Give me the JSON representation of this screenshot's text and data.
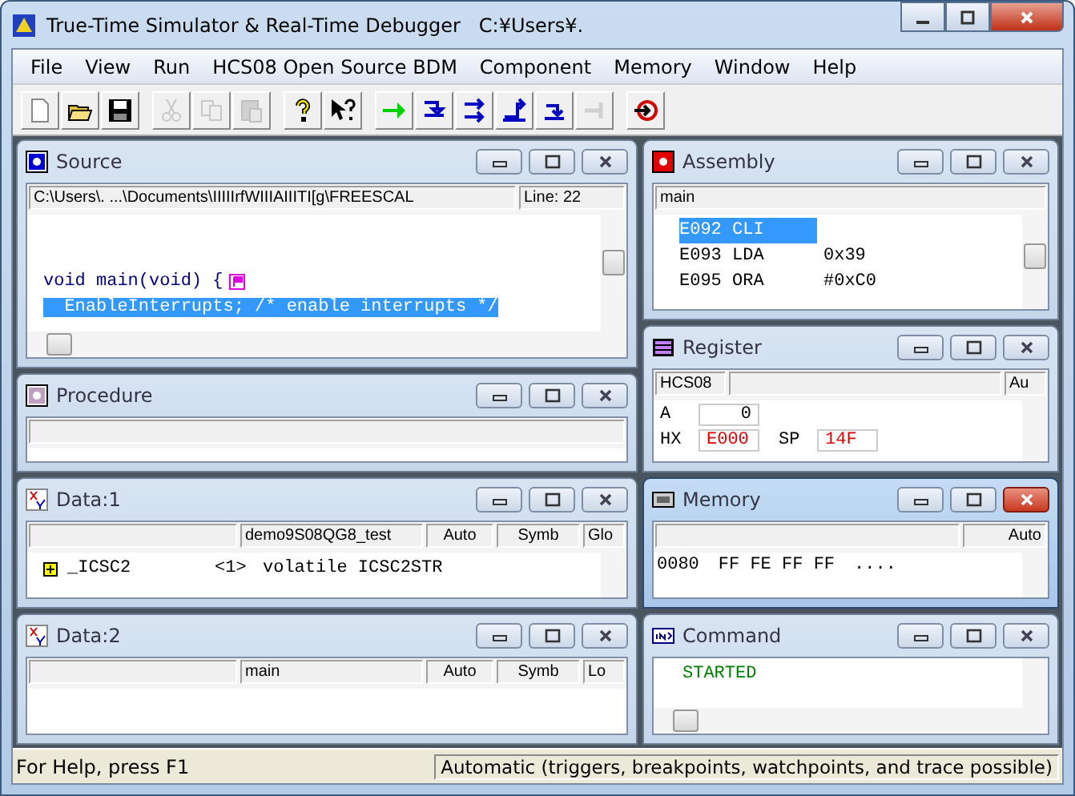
{
  "window": {
    "title": "True-Time Simulator & Real-Time Debugger   C:¥Users¥."
  },
  "menu": [
    "File",
    "View",
    "Run",
    "HCS08 Open Source BDM",
    "Component",
    "Memory",
    "Window",
    "Help"
  ],
  "toolbar": [
    {
      "kind": "new",
      "disabled": false
    },
    {
      "kind": "open",
      "disabled": false
    },
    {
      "kind": "save",
      "disabled": false
    },
    {
      "kind": "cut",
      "disabled": true
    },
    {
      "kind": "copy",
      "disabled": true
    },
    {
      "kind": "paste",
      "disabled": true
    },
    {
      "kind": "help",
      "disabled": false
    },
    {
      "kind": "context-help",
      "disabled": false
    },
    {
      "kind": "start",
      "disabled": false
    },
    {
      "kind": "step",
      "disabled": false
    },
    {
      "kind": "step-over",
      "disabled": false
    },
    {
      "kind": "step-out",
      "disabled": false
    },
    {
      "kind": "asm-step",
      "disabled": false
    },
    {
      "kind": "halt",
      "disabled": true
    },
    {
      "kind": "reset",
      "disabled": false
    }
  ],
  "left_panels": [
    {
      "kind": "source",
      "title": "Source",
      "active": false,
      "path": "C:\\Users\\. ...\\Documents\\IIIIIrfWIIIAIIITI[g\\FREESCAL",
      "line": "Line: 22",
      "lines": [
        {
          "text": "void main(void) {",
          "selected": false,
          "marker": true
        },
        {
          "text": "  EnableInterrupts; /* enable interrupts */",
          "selected": true,
          "marker": false
        }
      ]
    },
    {
      "kind": "procedure",
      "title": "Procedure",
      "active": false
    },
    {
      "kind": "data",
      "title": "Data:1",
      "active": false,
      "scope": "demo9S08QG8_test",
      "format": "Auto",
      "mode": "Symb",
      "visibility": "Glo",
      "rows": [
        {
          "name": "_ICSC2",
          "size": "<1>",
          "type": "volatile ICSC2STR",
          "expanded": false
        }
      ]
    },
    {
      "kind": "data",
      "title": "Data:2",
      "active": false,
      "scope": "main",
      "format": "Auto",
      "mode": "Symb",
      "visibility": "Lo"
    }
  ],
  "right_panels": [
    {
      "kind": "assembly",
      "title": "Assembly",
      "active": false,
      "function": "main",
      "rows": [
        {
          "addr": "E092",
          "op": "CLI",
          "selected": true
        },
        {
          "addr": "E093",
          "op": "LDA",
          "arg": "0x39",
          "selected": false
        },
        {
          "addr": "E095",
          "op": "ORA",
          "arg": "#0xC0",
          "selected": false
        }
      ]
    },
    {
      "kind": "register",
      "title": "Register",
      "active": false,
      "cpu": "HCS08",
      "format": "Au",
      "registers": [
        {
          "name": "A",
          "value": "0",
          "changed": false
        },
        {
          "name": "HX",
          "value": "E000",
          "changed": true
        },
        {
          "name": "SP",
          "value": "14F",
          "changed": true
        }
      ]
    },
    {
      "kind": "memory",
      "title": "Memory",
      "active": true,
      "format": "Auto",
      "rows": [
        {
          "addr": "0080",
          "bytes": "FF FE FF FF",
          "ascii": "...."
        }
      ]
    },
    {
      "kind": "command",
      "title": "Command",
      "active": false,
      "lines": [
        "STARTED"
      ]
    }
  ],
  "status_bar": {
    "help": "For Help, press F1",
    "mode": "Automatic (triggers, breakpoints, watchpoints, and trace possible)"
  }
}
